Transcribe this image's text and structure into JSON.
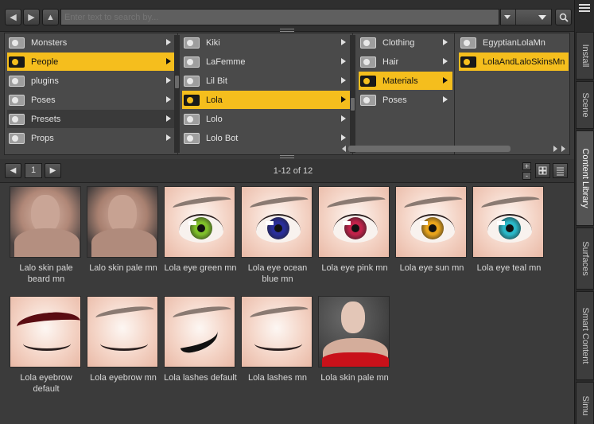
{
  "toolbar": {
    "back_icon": "arrow-left-icon",
    "forward_icon": "arrow-right-icon",
    "up_icon": "arrow-up-icon",
    "search_placeholder": "Enter text to search by..."
  },
  "tree": {
    "columns": [
      {
        "items": [
          {
            "label": "Monsters",
            "selected": false
          },
          {
            "label": "People",
            "selected": true
          },
          {
            "label": "plugins",
            "selected": false
          },
          {
            "label": "Poses",
            "selected": false
          },
          {
            "label": "Presets",
            "selected": false
          },
          {
            "label": "Props",
            "selected": false
          }
        ]
      },
      {
        "items": [
          {
            "label": "Kiki",
            "selected": false
          },
          {
            "label": "LaFemme",
            "selected": false
          },
          {
            "label": "Lil Bit",
            "selected": false
          },
          {
            "label": "Lola",
            "selected": true
          },
          {
            "label": "Lolo",
            "selected": false
          },
          {
            "label": "Lolo Bot",
            "selected": false
          }
        ]
      },
      {
        "items": [
          {
            "label": "Clothing",
            "selected": false
          },
          {
            "label": "Hair",
            "selected": false
          },
          {
            "label": "Materials",
            "selected": true
          },
          {
            "label": "Poses",
            "selected": false
          }
        ]
      },
      {
        "items": [
          {
            "label": "EgyptianLolaMn",
            "selected": false
          },
          {
            "label": "LolaAndLaloSkinsMn",
            "selected": true
          }
        ]
      }
    ]
  },
  "pager": {
    "page": "1",
    "count_text": "1-12 of 12",
    "zoom_in": "+",
    "zoom_out": "-"
  },
  "items": [
    {
      "label": "Lalo skin pale beard mn",
      "thumb": "skin-beard"
    },
    {
      "label": "Lalo skin pale mn",
      "thumb": "skin"
    },
    {
      "label": "Lola eye green mn",
      "thumb": "eye",
      "iris_color": "#7fbf2a"
    },
    {
      "label": "Lola eye ocean blue mn",
      "thumb": "eye",
      "iris_color": "#2a2e9a"
    },
    {
      "label": "Lola eye pink mn",
      "thumb": "eye",
      "iris_color": "#c0224a"
    },
    {
      "label": "Lola eye sun mn",
      "thumb": "eye",
      "iris_color": "#e8a41c"
    },
    {
      "label": "Lola eye teal mn",
      "thumb": "eye",
      "iris_color": "#2ab8c8"
    },
    {
      "label": "Lola eyebrow default",
      "thumb": "brow-red"
    },
    {
      "label": "Lola eyebrow mn",
      "thumb": "brow"
    },
    {
      "label": "Lola lashes default",
      "thumb": "lashes"
    },
    {
      "label": "Lola lashes mn",
      "thumb": "brow"
    },
    {
      "label": "Lola skin pale mn",
      "thumb": "figure"
    }
  ],
  "side_tabs": [
    {
      "label": "Install",
      "active": false
    },
    {
      "label": "Scene",
      "active": false
    },
    {
      "label": "Content Library",
      "active": true
    },
    {
      "label": "Surfaces",
      "active": false
    },
    {
      "label": "Smart Content",
      "active": false
    },
    {
      "label": "Simu",
      "active": false
    }
  ],
  "colors": {
    "accent": "#f5be1d",
    "panel": "#4a4a4a",
    "background": "#3b3b3b"
  }
}
